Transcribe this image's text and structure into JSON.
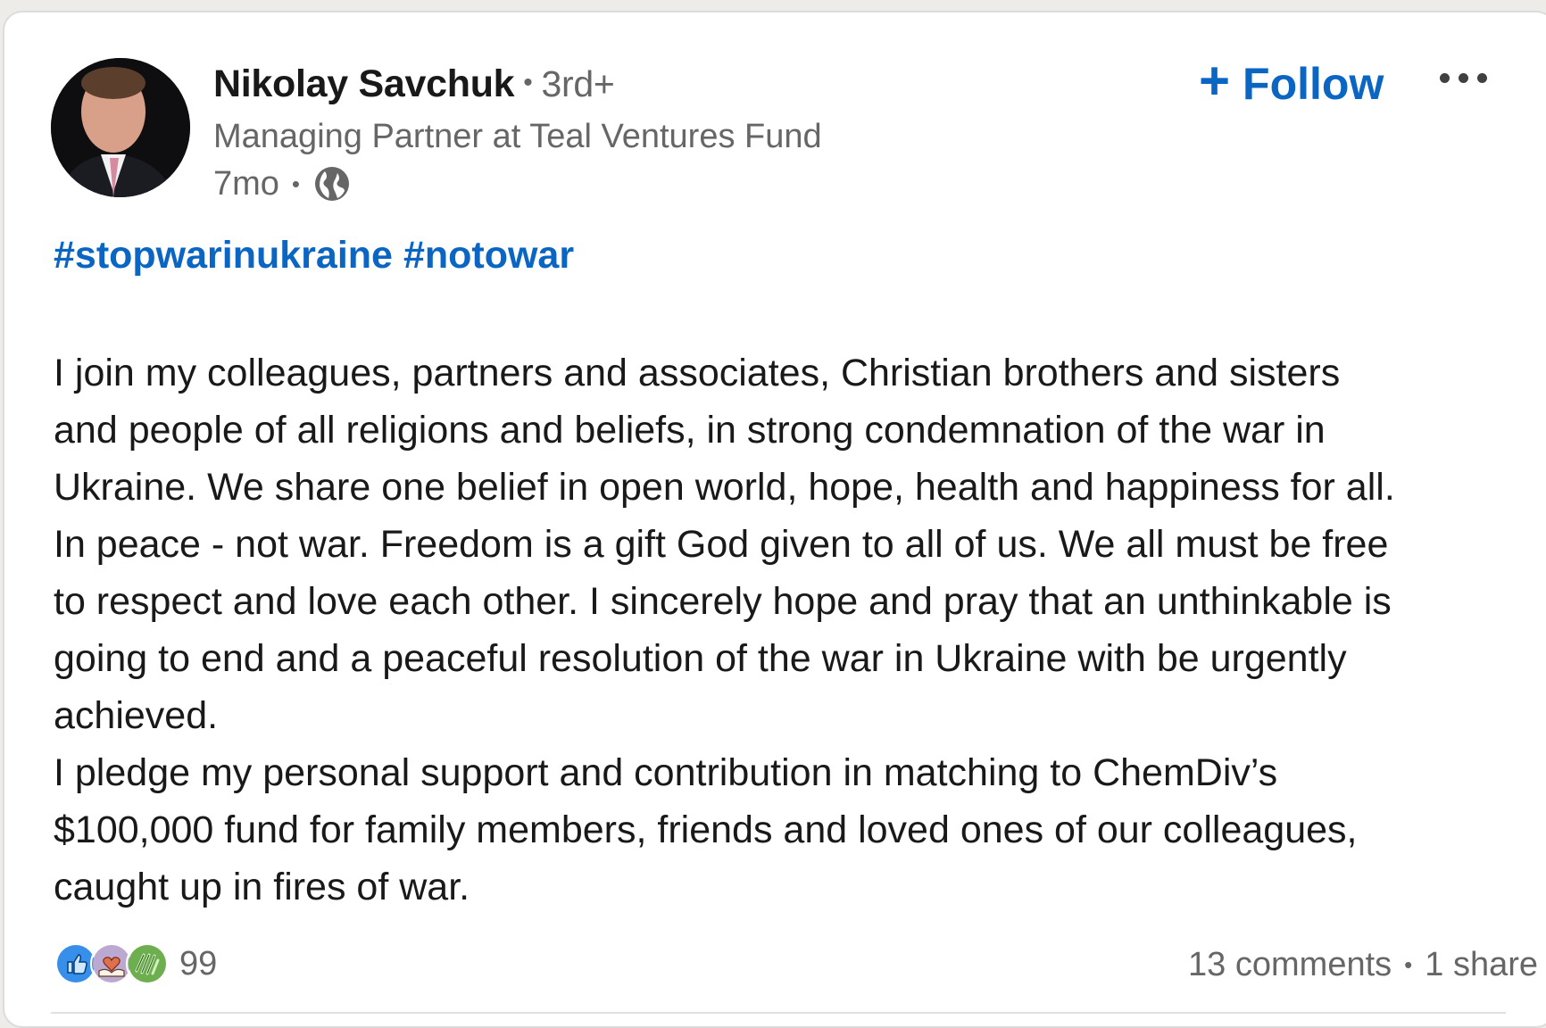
{
  "author": {
    "name": "Nikolay Savchuk",
    "connection_degree": "3rd+",
    "headline": "Managing Partner at Teal Ventures Fund",
    "time_ago": "7mo",
    "visibility_icon": "globe-icon"
  },
  "actions": {
    "follow_label": "Follow",
    "follow_icon": "plus-icon",
    "more_icon": "more-options-icon"
  },
  "post": {
    "hashtags": [
      "#stopwarinukraine",
      "#notowar"
    ],
    "lines": [
      "I join my colleagues, partners and associates, Christian brothers and sisters",
      "and people of all religions and beliefs, in strong condemnation of the war in",
      "Ukraine. We share one belief in open world, hope, health and happiness for all.",
      "In peace - not war. Freedom is a gift God given to all of us. We all must be free",
      "to respect and love each other. I sincerely hope and pray that an unthinkable is",
      "going to end and a peaceful resolution of the war in Ukraine with be urgently",
      "achieved.",
      "I pledge my personal support and contribution in matching to ChemDiv’s",
      "$100,000 fund for family members, friends and loved ones of our colleagues,",
      "caught up in fires of war."
    ]
  },
  "social": {
    "reactions": [
      "like-icon",
      "love-icon",
      "support-icon"
    ],
    "reaction_count": "99",
    "comments": "13 comments",
    "shares": "1 share"
  },
  "colors": {
    "brand_blue": "#0a66c2",
    "text_primary": "#191919",
    "text_secondary": "#666666"
  }
}
